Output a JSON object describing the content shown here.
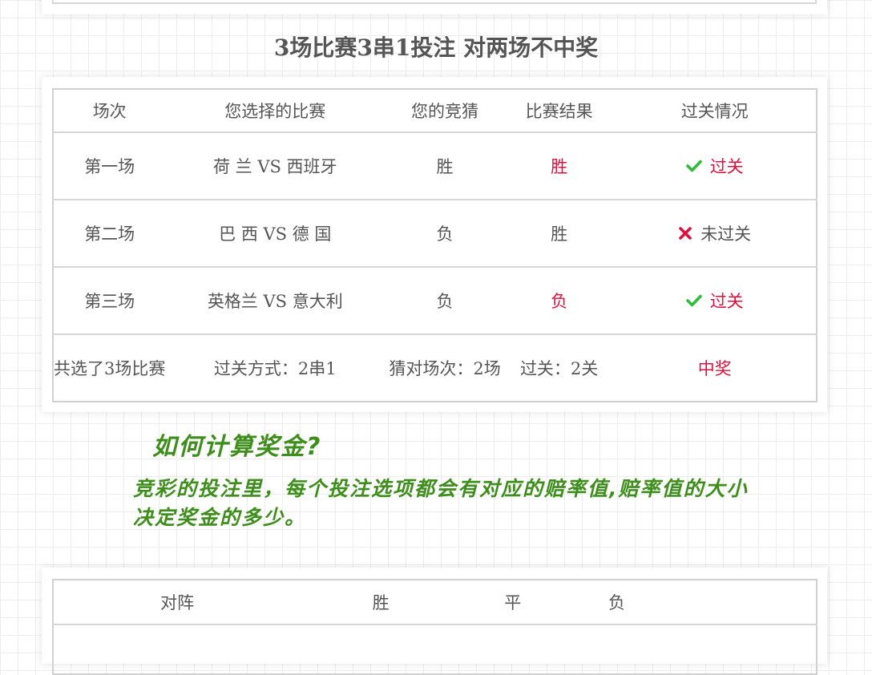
{
  "title": "3场比赛3串1投注 对两场不中奖",
  "headers": [
    "场次",
    "您选择的比赛",
    "您的竞猜",
    "比赛结果",
    "过关情况"
  ],
  "rows": [
    {
      "round": "第一场",
      "match": "荷 兰 VS 西班牙",
      "guess": "胜",
      "result": "胜",
      "result_red": true,
      "status": "过关",
      "status_icon": "check-icon"
    },
    {
      "round": "第二场",
      "match": "巴 西 VS 德 国",
      "guess": "负",
      "result": "胜",
      "result_red": false,
      "status": "未过关",
      "status_icon": "cross-icon"
    },
    {
      "round": "第三场",
      "match": "英格兰 VS 意大利",
      "guess": "负",
      "result": "负",
      "result_red": true,
      "status": "过关",
      "status_icon": "check-icon"
    }
  ],
  "summary": {
    "total": "共选了3场比赛",
    "mode": "过关方式：2串1",
    "correct": "猜对场次：2场",
    "passed": "过关：2关",
    "outcome": "中奖"
  },
  "how_title": "如何计算奖金?",
  "how_body": "竞彩的投注里，每个投注选项都会有对应的赔率值,赔率值的大小决定奖金的多少。",
  "odds_headers": [
    "对阵",
    "胜",
    "平",
    "负"
  ],
  "colors": {
    "accent_red": "#e0103b",
    "check_green": "#2dbd3a",
    "cross_red": "#e0103b",
    "hand_green": "#3e8e1c"
  }
}
